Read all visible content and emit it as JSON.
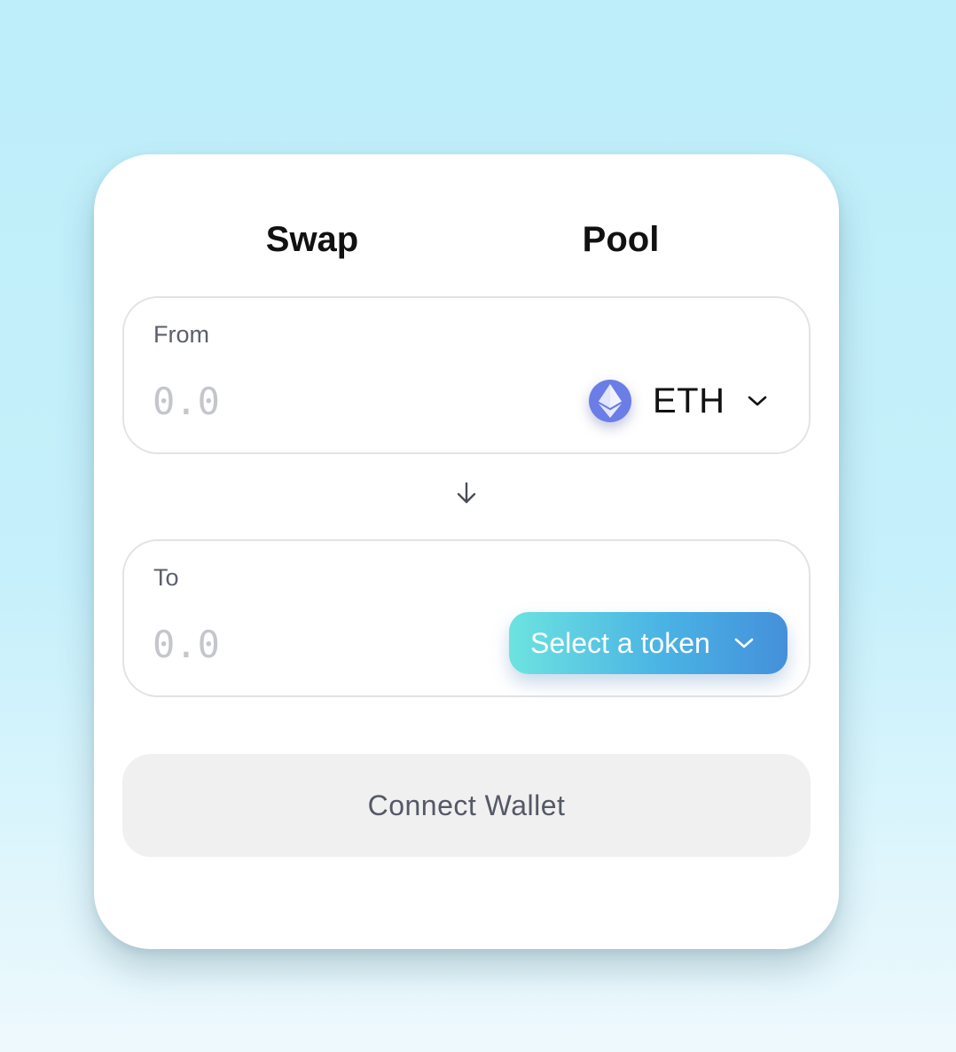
{
  "tabs": [
    {
      "label": "Swap"
    },
    {
      "label": "Pool"
    }
  ],
  "from": {
    "label": "From",
    "placeholder": "0.0",
    "token": {
      "symbol": "ETH",
      "icon": "ethereum-logo-icon",
      "color": "#6b7de6"
    }
  },
  "swap_direction_icon": "arrow-down-icon",
  "to": {
    "label": "To",
    "placeholder": "0.0",
    "select_token_label": "Select a token"
  },
  "connect_wallet_label": "Connect Wallet",
  "colors": {
    "background": "#bdeef9",
    "card": "#ffffff",
    "token_button_gradient_start": "#6de3e0",
    "token_button_gradient_end": "#4490da",
    "connect_button_bg": "#f0f0f0"
  }
}
